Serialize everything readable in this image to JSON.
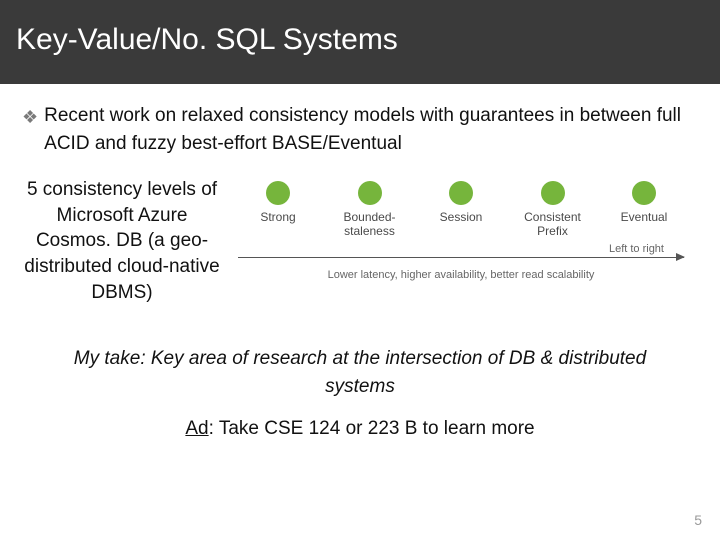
{
  "title": "Key-Value/No. SQL Systems",
  "bullet": "Recent work on relaxed consistency models with guarantees in between full ACID and fuzzy best-effort BASE/Eventual",
  "sidebar": "5 consistency levels of Microsoft Azure Cosmos. DB (a geo-distributed cloud-native DBMS)",
  "levels": {
    "l0": "Strong",
    "l1": "Bounded-\nstaleness",
    "l2": "Session",
    "l3": "Consistent\nPrefix",
    "l4": "Eventual"
  },
  "arrow": {
    "top": "Left to right",
    "bottom": "Lower latency, higher availability, better read scalability"
  },
  "take": "My take: Key area of research at the intersection of DB & distributed systems",
  "ad_prefix": "Ad",
  "ad_rest": ": Take CSE 124 or 223 B to learn more",
  "page": "5"
}
